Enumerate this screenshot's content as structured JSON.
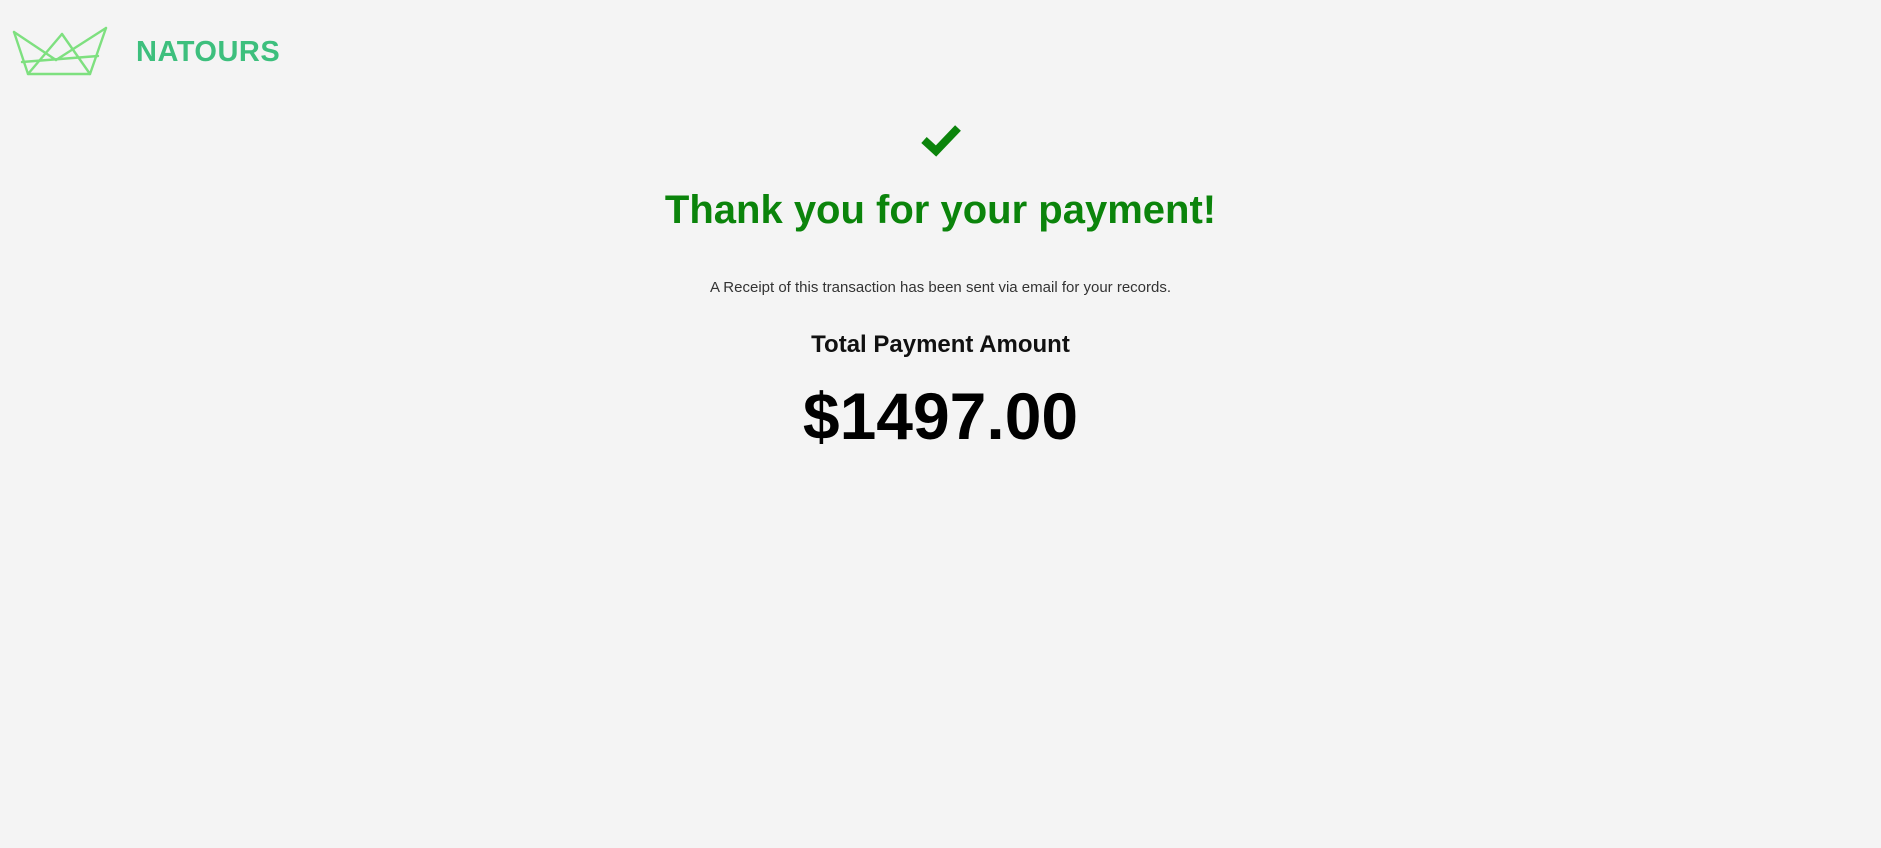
{
  "header": {
    "brand_name": "NATOURS",
    "logo_icon": "crown-logo-icon",
    "brand_color": "#3dbf7d"
  },
  "confirmation": {
    "status_icon": "checkmark-icon",
    "status_color": "#0b840b",
    "title": "Thank you for your payment!",
    "receipt_message": "A Receipt of this transaction has been sent via email for your records.",
    "amount_label": "Total Payment Amount",
    "amount_value": "$1497.00"
  }
}
